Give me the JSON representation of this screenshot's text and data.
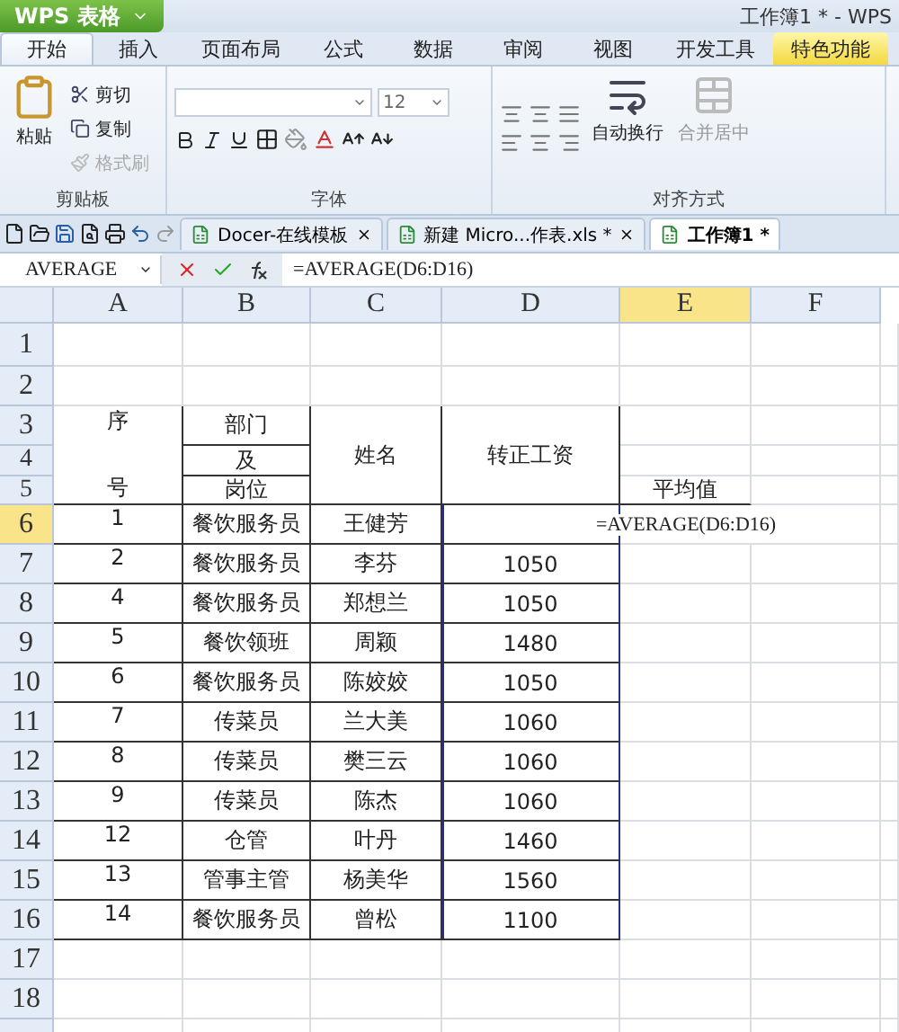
{
  "app_button": "WPS 表格",
  "window_title": "工作簿1 * - WPS",
  "ribbon_tabs": [
    {
      "label": "开始",
      "selected": true,
      "kind": "normal"
    },
    {
      "label": "插入",
      "selected": false,
      "kind": "normal"
    },
    {
      "label": "页面布局",
      "selected": false,
      "kind": "normal"
    },
    {
      "label": "公式",
      "selected": false,
      "kind": "normal"
    },
    {
      "label": "数据",
      "selected": false,
      "kind": "normal"
    },
    {
      "label": "审阅",
      "selected": false,
      "kind": "normal"
    },
    {
      "label": "视图",
      "selected": false,
      "kind": "normal"
    },
    {
      "label": "开发工具",
      "selected": false,
      "kind": "normal"
    },
    {
      "label": "特色功能",
      "selected": false,
      "kind": "special"
    }
  ],
  "clipboard": {
    "label": "剪贴板",
    "paste": "粘贴",
    "tools": [
      {
        "label": "剪切",
        "disabled": false
      },
      {
        "label": "复制",
        "disabled": false
      },
      {
        "label": "格式刷",
        "disabled": true
      }
    ]
  },
  "font": {
    "label": "字体",
    "size": "12"
  },
  "alignment": {
    "label": "对齐方式",
    "buttons": [
      {
        "label": "自动换行",
        "disabled": false
      },
      {
        "label": "合并居中",
        "disabled": true
      }
    ]
  },
  "doc_tabs": [
    {
      "label": "Docer-在线模板",
      "selected": false
    },
    {
      "label": "新建 Micro...作表.xls *",
      "selected": false
    },
    {
      "label": "工作簿1 *",
      "selected": true
    }
  ],
  "name_box": "AVERAGE",
  "formula": "=AVERAGE(D6:D16)",
  "columns": [
    {
      "label": "A",
      "selected": false
    },
    {
      "label": "B",
      "selected": false
    },
    {
      "label": "C",
      "selected": false
    },
    {
      "label": "D",
      "selected": false
    },
    {
      "label": "E",
      "selected": true
    },
    {
      "label": "F",
      "selected": false
    }
  ],
  "row_numbers": [
    {
      "label": "1",
      "selected": false
    },
    {
      "label": "2",
      "selected": false
    },
    {
      "label": "3",
      "selected": false
    },
    {
      "label": "4",
      "selected": false
    },
    {
      "label": "5",
      "selected": false
    },
    {
      "label": "6",
      "selected": true
    },
    {
      "label": "7",
      "selected": false
    },
    {
      "label": "8",
      "selected": false
    },
    {
      "label": "9",
      "selected": false
    },
    {
      "label": "10",
      "selected": false
    },
    {
      "label": "11",
      "selected": false
    },
    {
      "label": "12",
      "selected": false
    },
    {
      "label": "13",
      "selected": false
    },
    {
      "label": "14",
      "selected": false
    },
    {
      "label": "15",
      "selected": false
    },
    {
      "label": "16",
      "selected": false
    },
    {
      "label": "17",
      "selected": false
    },
    {
      "label": "18",
      "selected": false
    }
  ],
  "table": {
    "seq_header": [
      "序",
      "号"
    ],
    "dept_header": [
      "部门",
      "及",
      "岗位"
    ],
    "name_header": "姓名",
    "salary_header": "转正工资",
    "rows": [
      {
        "seq": "1",
        "dept": "餐饮服务员",
        "name": "王健芳",
        "salary": ""
      },
      {
        "seq": "2",
        "dept": "餐饮服务员",
        "name": "李芬",
        "salary": "1050"
      },
      {
        "seq": "4",
        "dept": "餐饮服务员",
        "name": "郑想兰",
        "salary": "1050"
      },
      {
        "seq": "5",
        "dept": "餐饮领班",
        "name": "周颖",
        "salary": "1480"
      },
      {
        "seq": "6",
        "dept": "餐饮服务员",
        "name": "陈姣姣",
        "salary": "1050"
      },
      {
        "seq": "7",
        "dept": "传菜员",
        "name": "兰大美",
        "salary": "1060"
      },
      {
        "seq": "8",
        "dept": "传菜员",
        "name": "樊三云",
        "salary": "1060"
      },
      {
        "seq": "9",
        "dept": "传菜员",
        "name": "陈杰",
        "salary": "1060"
      },
      {
        "seq": "12",
        "dept": "仓管",
        "name": "叶丹",
        "salary": "1460"
      },
      {
        "seq": "13",
        "dept": "管事主管",
        "name": "杨美华",
        "salary": "1560"
      },
      {
        "seq": "14",
        "dept": "餐饮服务员",
        "name": "曾松",
        "salary": "1100"
      }
    ]
  },
  "average_label": "平均值",
  "edit_cell": "=AVERAGE(D6:D16)"
}
